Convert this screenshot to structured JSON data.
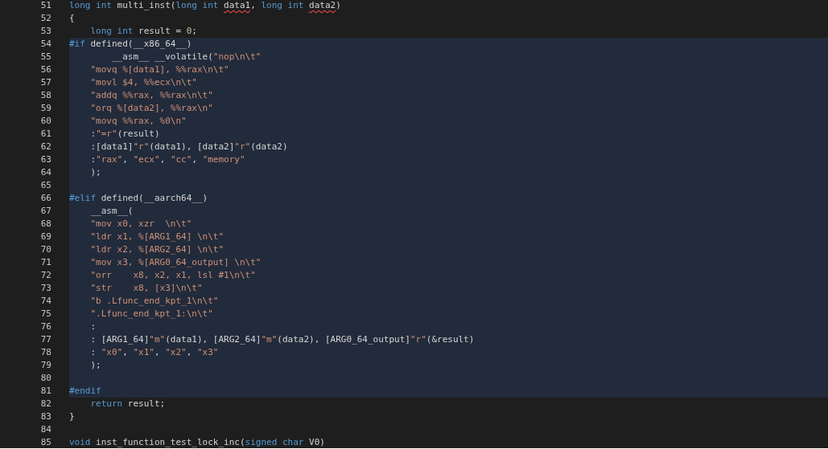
{
  "lines": [
    {
      "number": "51",
      "highlighted": false,
      "tokens": [
        {
          "kind": "keyword",
          "text": "long int"
        },
        {
          "kind": "plain",
          "text": " multi_inst("
        },
        {
          "kind": "keyword",
          "text": "long int "
        },
        {
          "kind": "plain",
          "text": "data1",
          "squiggle": true
        },
        {
          "kind": "plain",
          "text": ", "
        },
        {
          "kind": "keyword",
          "text": "long int "
        },
        {
          "kind": "plain",
          "text": "data2",
          "squiggle": true
        },
        {
          "kind": "plain",
          "text": ")"
        }
      ]
    },
    {
      "number": "52",
      "highlighted": false,
      "tokens": [
        {
          "kind": "plain",
          "text": "{"
        }
      ]
    },
    {
      "number": "53",
      "highlighted": false,
      "tokens": [
        {
          "kind": "keyword",
          "text": "    long int"
        },
        {
          "kind": "plain",
          "text": " result = "
        },
        {
          "kind": "number",
          "text": "0"
        },
        {
          "kind": "plain",
          "text": ";"
        }
      ]
    },
    {
      "number": "54",
      "highlighted": true,
      "tokens": [
        {
          "kind": "keyword",
          "text": "#if"
        },
        {
          "kind": "plain",
          "text": " defined(__x86_64__)"
        }
      ]
    },
    {
      "number": "55",
      "highlighted": true,
      "tokens": [
        {
          "kind": "plain",
          "text": "        __asm__ __volatile("
        },
        {
          "kind": "string",
          "text": "\"nop\\n\\t\""
        }
      ]
    },
    {
      "number": "56",
      "highlighted": true,
      "tokens": [
        {
          "kind": "string",
          "text": "    \"movq %[data1], %%rax\\n\\t\""
        }
      ]
    },
    {
      "number": "57",
      "highlighted": true,
      "tokens": [
        {
          "kind": "string",
          "text": "    \"movl $4, %%ecx\\n\\t\""
        }
      ]
    },
    {
      "number": "58",
      "highlighted": true,
      "tokens": [
        {
          "kind": "string",
          "text": "    \"addq %%rax, %%rax\\n\\t\""
        }
      ]
    },
    {
      "number": "59",
      "highlighted": true,
      "tokens": [
        {
          "kind": "string",
          "text": "    \"orq %[data2], %%rax\\n\""
        }
      ]
    },
    {
      "number": "60",
      "highlighted": true,
      "tokens": [
        {
          "kind": "string",
          "text": "    \"movq %%rax, %0\\n\""
        }
      ]
    },
    {
      "number": "61",
      "highlighted": true,
      "tokens": [
        {
          "kind": "plain",
          "text": "    :"
        },
        {
          "kind": "string",
          "text": "\"=r\""
        },
        {
          "kind": "plain",
          "text": "(result)"
        }
      ]
    },
    {
      "number": "62",
      "highlighted": true,
      "tokens": [
        {
          "kind": "plain",
          "text": "    :[data1]"
        },
        {
          "kind": "string",
          "text": "\"r\""
        },
        {
          "kind": "plain",
          "text": "(data1), [data2]"
        },
        {
          "kind": "string",
          "text": "\"r\""
        },
        {
          "kind": "plain",
          "text": "(data2)"
        }
      ]
    },
    {
      "number": "63",
      "highlighted": true,
      "tokens": [
        {
          "kind": "plain",
          "text": "    :"
        },
        {
          "kind": "string",
          "text": "\"rax\""
        },
        {
          "kind": "plain",
          "text": ", "
        },
        {
          "kind": "string",
          "text": "\"ecx\""
        },
        {
          "kind": "plain",
          "text": ", "
        },
        {
          "kind": "string",
          "text": "\"cc\""
        },
        {
          "kind": "plain",
          "text": ", "
        },
        {
          "kind": "string",
          "text": "\"memory\""
        }
      ]
    },
    {
      "number": "64",
      "highlighted": true,
      "tokens": [
        {
          "kind": "plain",
          "text": "    );"
        }
      ]
    },
    {
      "number": "65",
      "highlighted": true
    },
    {
      "number": "66",
      "highlighted": true,
      "tokens": [
        {
          "kind": "keyword",
          "text": "#elif"
        },
        {
          "kind": "plain",
          "text": " defined(__aarch64__)"
        }
      ]
    },
    {
      "number": "67",
      "highlighted": true,
      "tokens": [
        {
          "kind": "plain",
          "text": "    __asm__("
        }
      ]
    },
    {
      "number": "68",
      "highlighted": true,
      "tokens": [
        {
          "kind": "string",
          "text": "    \"mov x0, xzr  \\n\\t\""
        }
      ]
    },
    {
      "number": "69",
      "highlighted": true,
      "tokens": [
        {
          "kind": "string",
          "text": "    \"ldr x1, %[ARG1_64] \\n\\t\""
        }
      ]
    },
    {
      "number": "70",
      "highlighted": true,
      "tokens": [
        {
          "kind": "string",
          "text": "    \"ldr x2, %[ARG2_64] \\n\\t\""
        }
      ]
    },
    {
      "number": "71",
      "highlighted": true,
      "tokens": [
        {
          "kind": "string",
          "text": "    \"mov x3, %[ARG0_64_output] \\n\\t\""
        }
      ]
    },
    {
      "number": "72",
      "highlighted": true,
      "tokens": [
        {
          "kind": "string",
          "text": "    \"orr    x8, x2, x1, lsl #1\\n\\t\""
        }
      ]
    },
    {
      "number": "73",
      "highlighted": true,
      "tokens": [
        {
          "kind": "string",
          "text": "    \"str    x8, [x3]\\n\\t\""
        }
      ]
    },
    {
      "number": "74",
      "highlighted": true,
      "tokens": [
        {
          "kind": "string",
          "text": "    \"b .Lfunc_end_kpt_1\\n\\t\""
        }
      ]
    },
    {
      "number": "75",
      "highlighted": true,
      "tokens": [
        {
          "kind": "string",
          "text": "    \".Lfunc_end_kpt_1:\\n\\t\""
        }
      ]
    },
    {
      "number": "76",
      "highlighted": true,
      "tokens": [
        {
          "kind": "plain",
          "text": "    :"
        }
      ]
    },
    {
      "number": "77",
      "highlighted": true,
      "tokens": [
        {
          "kind": "plain",
          "text": "    : [ARG1_64]"
        },
        {
          "kind": "string",
          "text": "\"m\""
        },
        {
          "kind": "plain",
          "text": "(data1), [ARG2_64]"
        },
        {
          "kind": "string",
          "text": "\"m\""
        },
        {
          "kind": "plain",
          "text": "(data2), [ARG0_64_output]"
        },
        {
          "kind": "string",
          "text": "\"r\""
        },
        {
          "kind": "plain",
          "text": "(&result)"
        }
      ]
    },
    {
      "number": "78",
      "highlighted": true,
      "tokens": [
        {
          "kind": "plain",
          "text": "    : "
        },
        {
          "kind": "string",
          "text": "\"x0\""
        },
        {
          "kind": "plain",
          "text": ", "
        },
        {
          "kind": "string",
          "text": "\"x1\""
        },
        {
          "kind": "plain",
          "text": ", "
        },
        {
          "kind": "string",
          "text": "\"x2\""
        },
        {
          "kind": "plain",
          "text": ", "
        },
        {
          "kind": "string",
          "text": "\"x3\""
        }
      ]
    },
    {
      "number": "79",
      "highlighted": true,
      "tokens": [
        {
          "kind": "plain",
          "text": "    );"
        }
      ]
    },
    {
      "number": "80",
      "highlighted": true
    },
    {
      "number": "81",
      "highlighted": true,
      "tokens": [
        {
          "kind": "keyword",
          "text": "#endif"
        }
      ]
    },
    {
      "number": "82",
      "highlighted": false,
      "tokens": [
        {
          "kind": "keyword",
          "text": "    return"
        },
        {
          "kind": "plain",
          "text": " result;"
        }
      ]
    },
    {
      "number": "83",
      "highlighted": false,
      "tokens": [
        {
          "kind": "plain",
          "text": "}"
        }
      ]
    },
    {
      "number": "84",
      "highlighted": false
    },
    {
      "number": "85",
      "highlighted": false,
      "tokens": [
        {
          "kind": "keyword",
          "text": "void"
        },
        {
          "kind": "plain",
          "text": " inst_function_test_lock_inc("
        },
        {
          "kind": "keyword",
          "text": "signed char"
        },
        {
          "kind": "plain",
          "text": " V0)"
        }
      ]
    }
  ]
}
